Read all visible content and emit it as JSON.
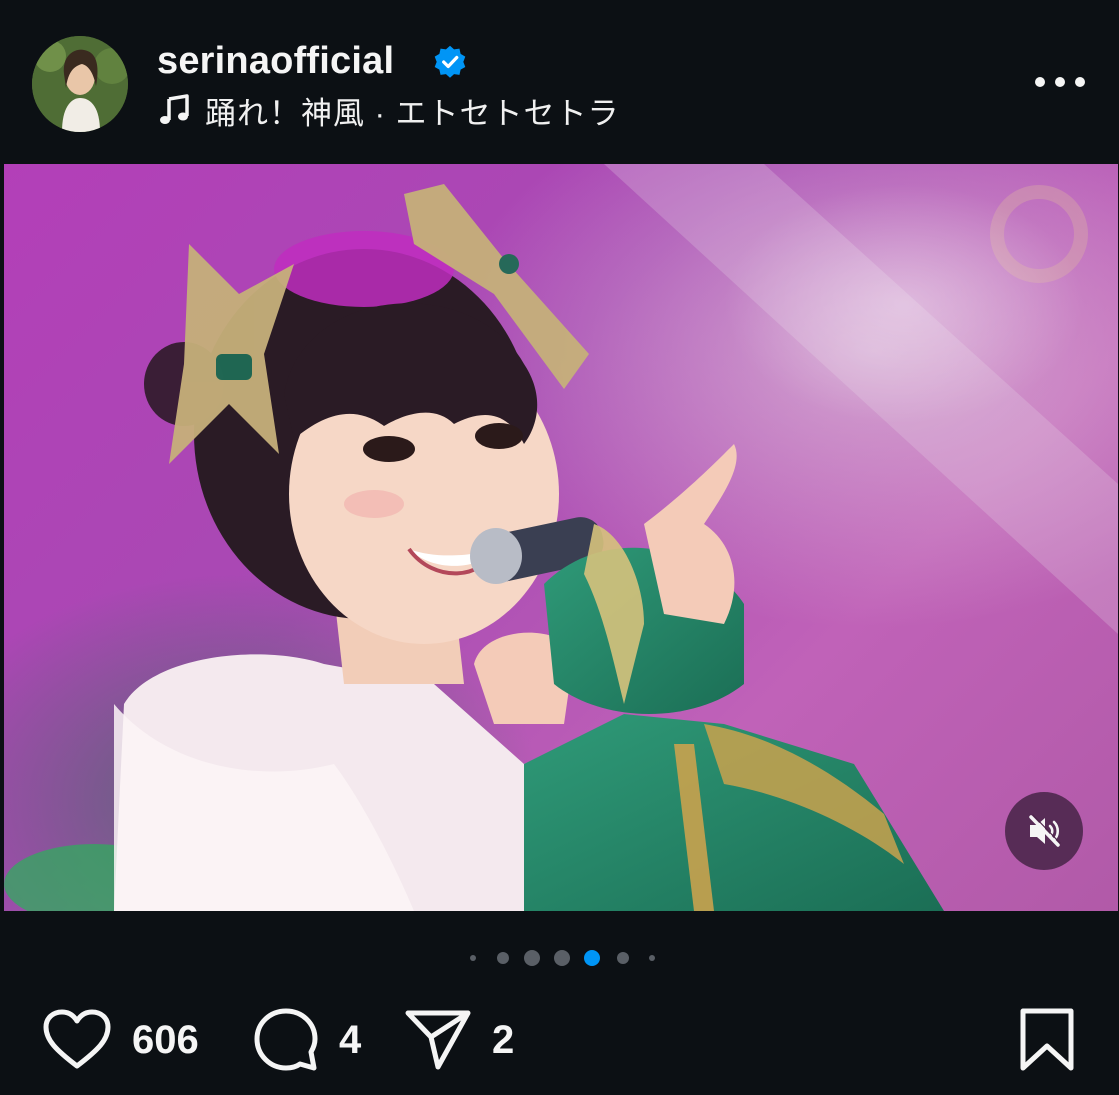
{
  "header": {
    "username": "serinaofficial",
    "verified": true,
    "music": {
      "icon": "music-note-icon",
      "text": "踊れ！神風 · エトセトセトラ"
    },
    "more_icon": "more-options-icon"
  },
  "media": {
    "type": "video",
    "muted": true,
    "mute_icon": "speaker-muted-icon"
  },
  "carousel": {
    "total": 7,
    "active_index": 4
  },
  "actions": {
    "like_count": "606",
    "comment_count": "4",
    "share_count": "2"
  },
  "colors": {
    "background": "#0c1014",
    "text": "#f5f5f5",
    "verified_badge": "#0095f6",
    "active_dot": "#0095f6",
    "inactive_dot": "#5a5f66"
  }
}
